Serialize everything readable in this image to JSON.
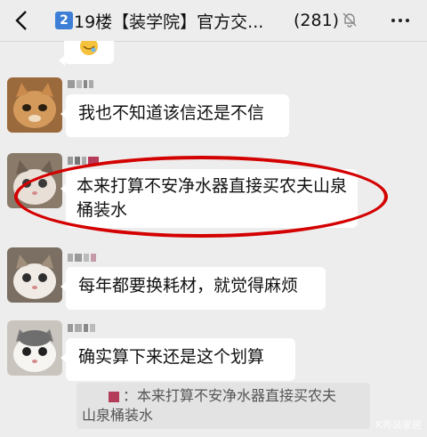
{
  "header": {
    "back_icon": "chevron-left-icon",
    "title_badge": "2",
    "title": "19楼【装学院】官方交...",
    "member_count": "(281)",
    "mute_icon": "bell-muted-icon",
    "more_icon": "more-dots-icon"
  },
  "messages": [
    {
      "text": "我也不知道该信还是不信"
    },
    {
      "text": "本来打算不安净水器直接买农夫山泉桶装水"
    },
    {
      "text": "每年都要换耗材，就觉得麻烦"
    },
    {
      "text": "确实算下来还是这个划算"
    }
  ],
  "quote": {
    "text_line1": "：本来打算不安净水器直接买农夫",
    "text_line2": "山泉桶装水"
  },
  "watermark": "K秀装家居"
}
